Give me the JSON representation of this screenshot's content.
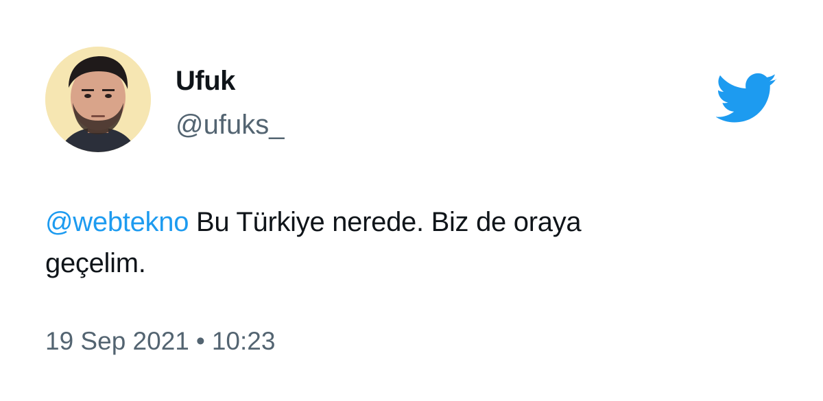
{
  "user": {
    "display_name": "Ufuk",
    "handle": "@ufuks_"
  },
  "tweet": {
    "mention": "@webtekno",
    "text_line1": " Bu Türkiye nerede. Biz de oraya",
    "text_line2": "geçelim."
  },
  "meta": {
    "date": "19 Sep 2021",
    "separator": "•",
    "time": "10:23"
  },
  "icons": {
    "brand": "twitter-bird-icon"
  },
  "colors": {
    "brand": "#1d9bf0",
    "text": "#0f1419",
    "muted": "#536471",
    "avatar_bg": "#f6e6b2"
  }
}
